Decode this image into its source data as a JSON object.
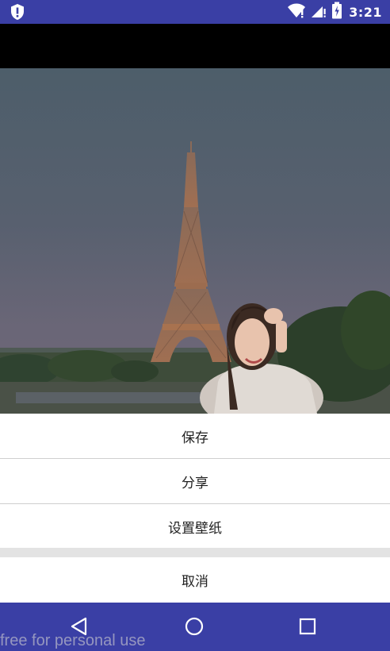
{
  "status_bar": {
    "time": "3:21",
    "icons": [
      "shield-alert-icon",
      "wifi-icon",
      "cell-signal-icon",
      "battery-icon"
    ]
  },
  "photo": {
    "description_icon": "eiffel-tower-photo"
  },
  "action_sheet": {
    "items": [
      {
        "label": "保存"
      },
      {
        "label": "分享"
      },
      {
        "label": "设置壁纸"
      }
    ],
    "cancel_label": "取消"
  },
  "nav_bar": {
    "icons": [
      "back-triangle-icon",
      "home-circle-icon",
      "recents-square-icon"
    ]
  },
  "watermark": "free for personal use",
  "colors": {
    "primary": "#3a3fa5",
    "sheet_bg": "#ffffff",
    "divider": "#cfcfcf",
    "gap": "#e3e3e3"
  }
}
